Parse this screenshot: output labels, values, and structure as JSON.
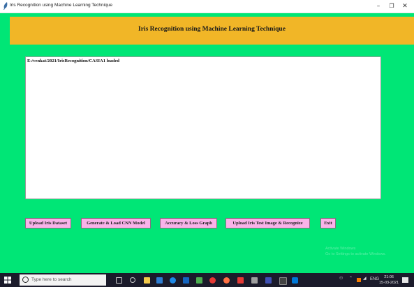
{
  "window": {
    "title": "Iris Recognition using Machine Learning Technique",
    "minimize_label": "–",
    "maximize_label": "❐",
    "close_label": "✕"
  },
  "header": {
    "title": "Iris Recognition using Machine Learning Technique"
  },
  "output": {
    "text": "E:/venkat/2021/IrisRecognition/CASIA1 loaded"
  },
  "buttons": [
    {
      "label": "Upload Iris Dataset"
    },
    {
      "label": "Generate & Load CNN Model"
    },
    {
      "label": "Accuracy & Loss Graph"
    },
    {
      "label": "Upload Iris Test Image & Recognize"
    },
    {
      "label": "Exit"
    }
  ],
  "watermark": {
    "line1": "Activate Windows",
    "line2": "Go to Settings to activate Windows."
  },
  "taskbar": {
    "search_placeholder": "Type here to search",
    "tray_text": "ENG",
    "time": "21:06",
    "date": "15-03-2021",
    "icons": [
      "task-view-icon",
      "cortana-icon",
      "store-icon",
      "edge-icon",
      "file-explorer-icon",
      "mail-icon",
      "media-icon",
      "chrome-icon",
      "app-icon",
      "folder-icon",
      "python-icon",
      "terminal-icon",
      "python-idle-icon"
    ],
    "accent": "#0078d7"
  },
  "colors": {
    "background": "#00e676",
    "header": "#f1b627",
    "button": "#f9b2e9"
  }
}
